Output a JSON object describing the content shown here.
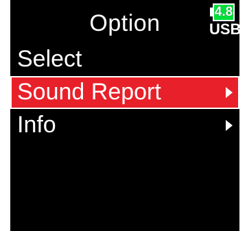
{
  "header": {
    "title": "Option"
  },
  "status": {
    "battery_level": "4.8",
    "power_source": "USB",
    "battery_color": "#00e13a"
  },
  "menu": {
    "items": [
      {
        "label": "Select",
        "has_arrow": false,
        "selected": false
      },
      {
        "label": "Sound Report",
        "has_arrow": true,
        "selected": true
      },
      {
        "label": "Info",
        "has_arrow": true,
        "selected": false
      }
    ]
  },
  "colors": {
    "selection": "#e8202a",
    "background": "#000000",
    "text": "#ffffff"
  }
}
